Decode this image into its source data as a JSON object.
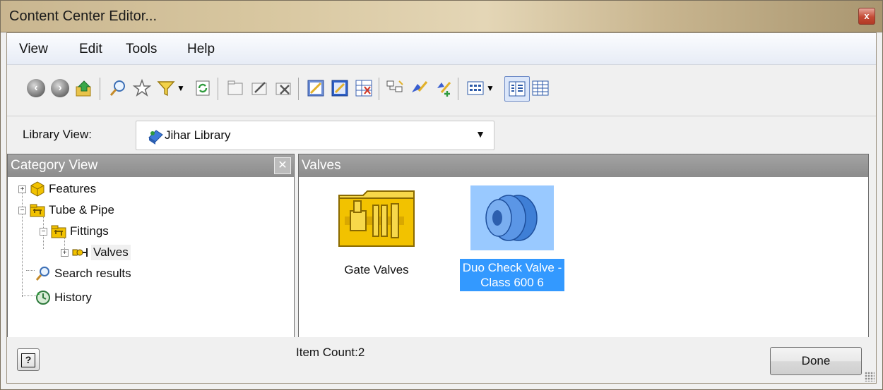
{
  "window": {
    "title": "Content Center Editor...",
    "close_label": "x"
  },
  "menu": [
    "View",
    "Edit",
    "Tools",
    "Help"
  ],
  "library": {
    "label": "Library View:",
    "selected": "Jihar Library"
  },
  "category_panel": {
    "title": "Category View",
    "tree": [
      {
        "label": "Features"
      },
      {
        "label": "Tube & Pipe"
      },
      {
        "label": "Fittings"
      },
      {
        "label": "Valves"
      },
      {
        "label": "Search results"
      },
      {
        "label": "History"
      }
    ]
  },
  "items_panel": {
    "title": "Valves",
    "items": [
      {
        "label": "Gate Valves"
      },
      {
        "label": "Duo Check Valve -\nClass 600 6"
      }
    ]
  },
  "status": {
    "item_count": "Item Count:2"
  },
  "buttons": {
    "help": "?",
    "done": "Done"
  },
  "colors": {
    "selection": "#3399ff",
    "panel_header": "#8c8c8c",
    "folder": "#f2c200"
  }
}
